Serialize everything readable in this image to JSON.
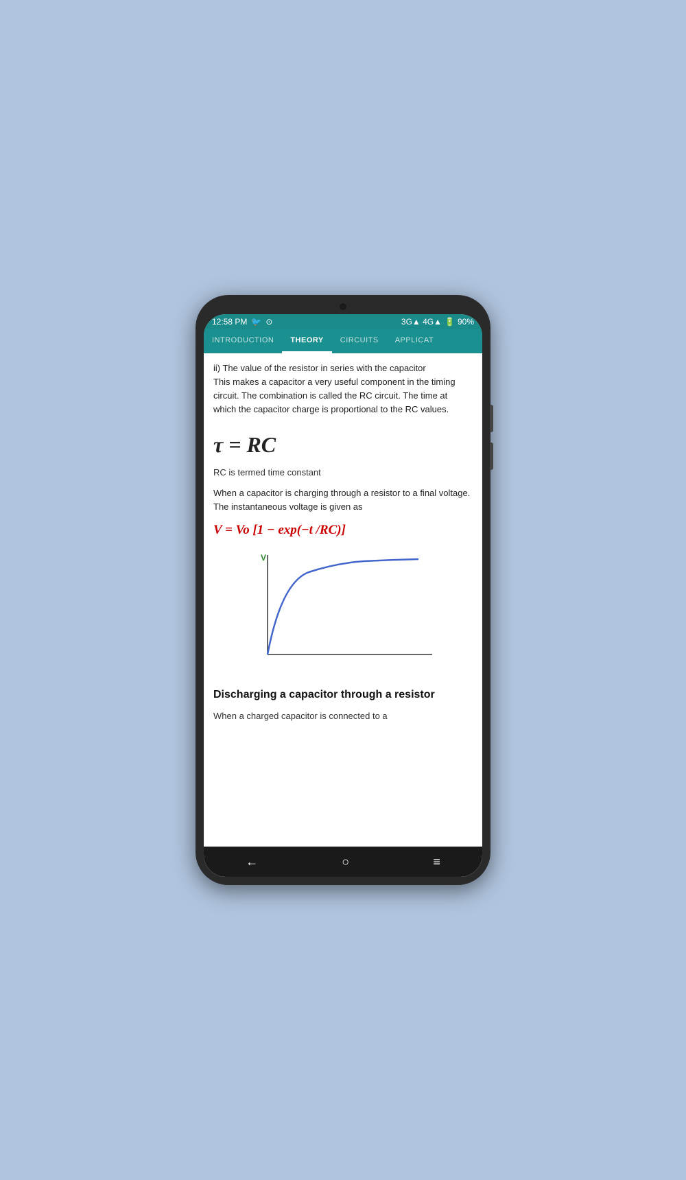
{
  "statusBar": {
    "time": "12:58 PM",
    "network": "3G▲ 4G▲",
    "battery": "90%"
  },
  "navTabs": [
    {
      "label": "INTRODUCTION",
      "active": false
    },
    {
      "label": "THEORY",
      "active": false
    },
    {
      "label": "CIRCUITS",
      "active": true
    },
    {
      "label": "APPLICAT",
      "active": false
    }
  ],
  "content": {
    "intro1": "ii) The value of the resistor in series with the capacitor",
    "intro2": "This makes a capacitor a very useful component in the timing circuit. The combination is called the RC circuit. The time at which the capacitor charge is proportional to the RC values.",
    "formulaTau": "τ = RC",
    "timeConstantLabel": "RC is termed time constant",
    "chargingText": "When a capacitor is charging through a resistor to a final voltage. The instantaneous voltage is given as",
    "formulaV": "V = Vo [1 − exp(−t /RC)]",
    "chartYLabel": "V",
    "dischargeHeading": "Discharging a capacitor through a resistor",
    "dischargeText": "When a charged capacitor is connected to a"
  },
  "bottomNav": {
    "backLabel": "←",
    "homeLabel": "○",
    "menuLabel": "≡"
  }
}
